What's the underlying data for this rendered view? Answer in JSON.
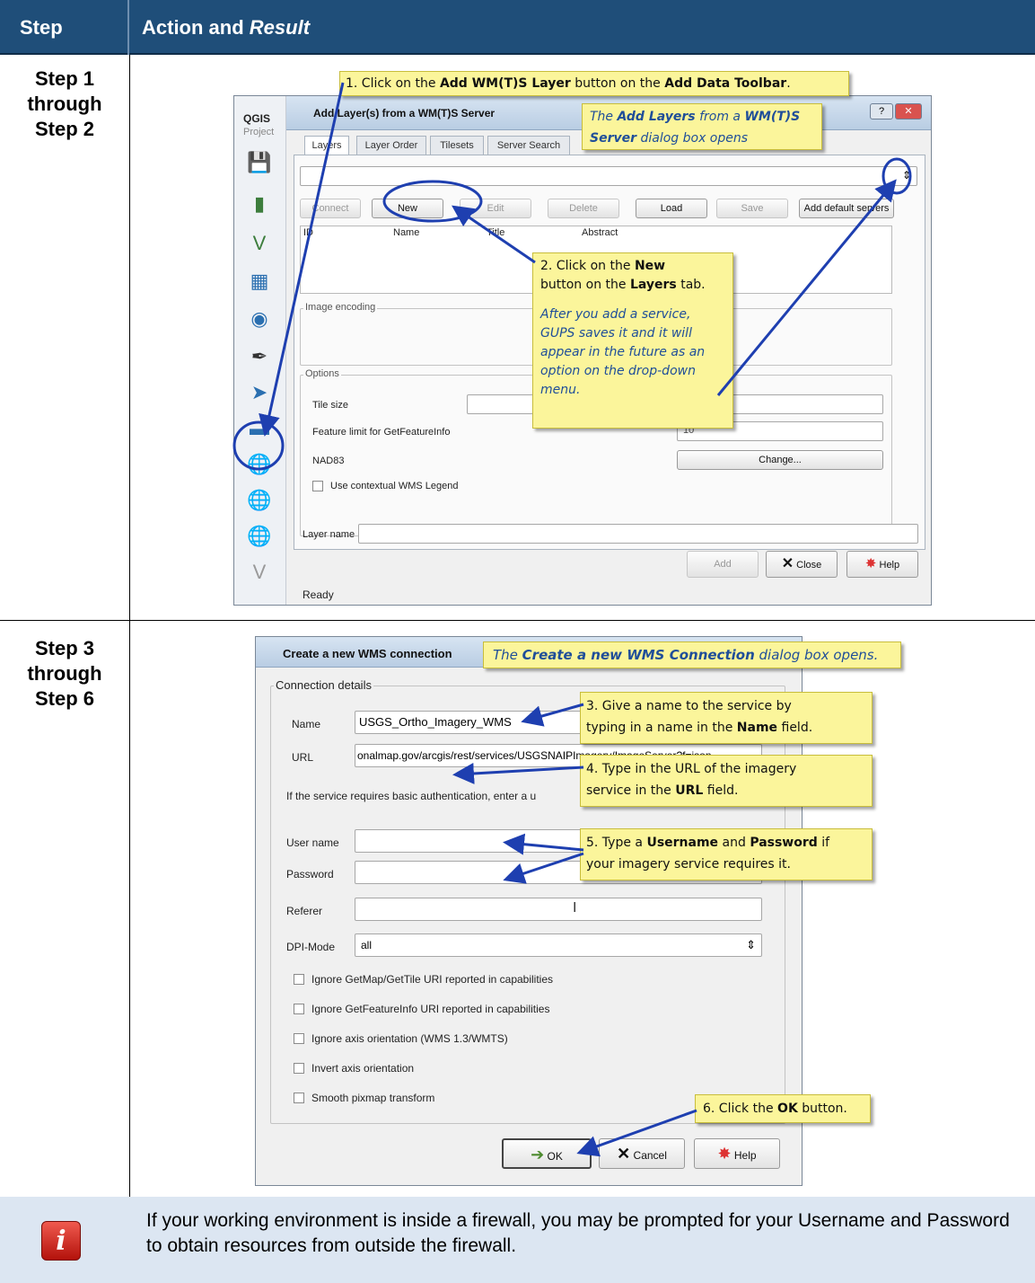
{
  "header": {
    "step": "Step",
    "action_prefix": "Action and ",
    "action_italic": "Result"
  },
  "rows": [
    {
      "label_lines": [
        "Step 1",
        "through",
        "Step 2"
      ]
    },
    {
      "label_lines": [
        "Step 3",
        "through",
        "Step 6"
      ]
    }
  ],
  "shot1": {
    "qgis_title": "QGIS",
    "qgis_menu": "Project",
    "dialog_title": "Add Layer(s) from a WM(T)S Server",
    "tabs": [
      "Layers",
      "Layer Order",
      "Tilesets",
      "Server Search"
    ],
    "buttons": {
      "connect": "Connect",
      "new": "New",
      "edit": "Edit",
      "delete": "Delete",
      "load": "Load",
      "save": "Save",
      "add_default": "Add default servers"
    },
    "columns": [
      "ID",
      "Name",
      "Title",
      "Abstract"
    ],
    "image_encoding": "Image encoding",
    "options": "Options",
    "tile_size": "Tile size",
    "feature_limit": "Feature limit for GetFeatureInfo",
    "feature_limit_value": "10",
    "crs": "NAD83",
    "change": "Change...",
    "contextual_legend": "Use contextual WMS Legend",
    "layer_name": "Layer name",
    "add": "Add",
    "close": "Close",
    "help": "Help",
    "status": "Ready",
    "callout1": {
      "pre": "1. Click on the ",
      "b1": "Add WM(T)S Layer",
      "mid": " button on the ",
      "b2": "Add Data Toolbar",
      "post": "."
    },
    "callout_opens": {
      "pre": "The ",
      "b1": "Add Layers",
      "mid": " from a ",
      "b2": "WM(T)S",
      "line2_b": "Server",
      "line2": " dialog box opens"
    },
    "callout2": {
      "pre": "2. Click on the ",
      "b1": "New",
      "line2_pre": "button on the ",
      "b2": "Layers",
      "line2_post": " tab."
    },
    "callout2_note": [
      "After you add a service,",
      "GUPS saves it and it will",
      "appear in the future as an",
      "option on the drop-down",
      "menu."
    ]
  },
  "shot2": {
    "dialog_title": "Create a new WMS connection",
    "connection_details": "Connection details",
    "name_label": "Name",
    "name_value": "USGS_Ortho_Imagery_WMS",
    "url_label": "URL",
    "url_value": "onalmap.gov/arcgis/rest/services/USGSNAIPImagery/ImageServer?f=json",
    "auth_text": "If the service requires basic authentication, enter a u",
    "username_label": "User name",
    "password_label": "Password",
    "referer_label": "Referer",
    "dpi_label": "DPI-Mode",
    "dpi_value": "all",
    "checks": [
      "Ignore GetMap/GetTile URI reported in capabilities",
      "Ignore GetFeatureInfo URI reported in capabilities",
      "Ignore axis orientation (WMS 1.3/WMTS)",
      "Invert axis orientation",
      "Smooth pixmap transform"
    ],
    "ok": "OK",
    "cancel": "Cancel",
    "help": "Help",
    "callout_opens": {
      "pre": "The ",
      "b": "Create a new WMS Connection",
      "post": " dialog box opens."
    },
    "callout3": {
      "line1": "3. Give a name to the service by",
      "line2_pre": "typing in a name in the ",
      "b": "Name",
      "line2_post": " field."
    },
    "callout4": {
      "line1": "4. Type in the URL of the imagery",
      "line2_pre": "service in the ",
      "b": "URL",
      "line2_post": " field."
    },
    "callout5": {
      "pre": "5. Type a ",
      "b1": "Username",
      "mid": " and ",
      "b2": "Password",
      "post": " if",
      "line2": "your imagery service requires it."
    },
    "callout6": {
      "pre": "6. Click the ",
      "b": "OK",
      "post": " button."
    }
  },
  "note": {
    "icon": "info-icon",
    "text": "If your working environment is inside a firewall, you may be prompted for your Username and Password to obtain resources from outside the firewall."
  }
}
